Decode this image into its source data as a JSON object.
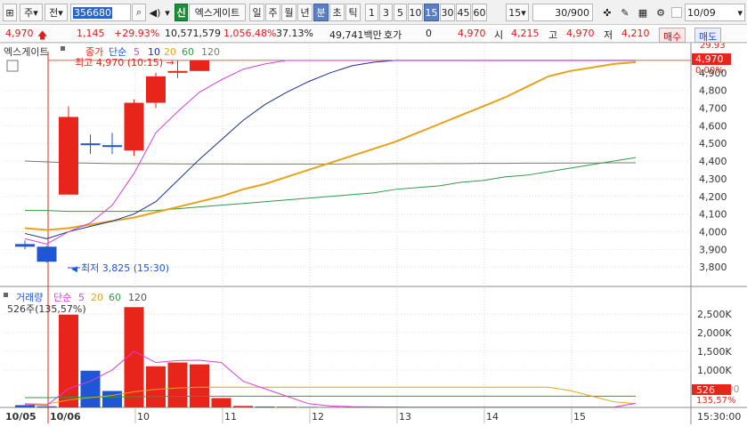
{
  "toolbar": {
    "market_label": "주",
    "type_label": "전",
    "code_value": "356680",
    "name_badge": "신",
    "stock_name": "엑스게이트",
    "periods": [
      "일",
      "주",
      "월",
      "년",
      "분",
      "초",
      "틱"
    ],
    "period_selected": "분",
    "intervals": [
      "1",
      "3",
      "5",
      "10",
      "15",
      "30",
      "45",
      "60"
    ],
    "interval_selected": "15",
    "interval_select": "15",
    "count_value": "30/900",
    "date_value": "10/09"
  },
  "quote": {
    "price": "4,970",
    "change": "1,145",
    "change_pct": "+29.93%",
    "volume": "10,571,579",
    "volume_pct": "1,056.48%",
    "turnover_pct": "37.13%",
    "amount": "49,741백만",
    "hoga_label": "호가",
    "hoga_value": "0",
    "current": "4,970",
    "open_label": "시",
    "open": "4,215",
    "high_label": "고",
    "high": "4,970",
    "low_label": "저",
    "low": "4,210",
    "buy_label": "매수",
    "sell_label": "매도"
  },
  "colors": {
    "up": "#e8251a",
    "down": "#1f56d4",
    "ma5": "#d63fd6",
    "ma10": "#1a2f8f",
    "ma20": "#e8a21a",
    "ma60": "#2e9b45",
    "ma120": "#7a7a6a"
  },
  "chart_data": [
    {
      "type": "candlestick",
      "title": "엑스게이트",
      "legend": [
        "종가",
        "단순",
        "5",
        "10",
        "20",
        "60",
        "120"
      ],
      "x": [
        "10/05 15:00",
        "10/05 15:15",
        "10/06 09:00",
        "10/06 09:15",
        "10/06 09:30",
        "10/06 09:45",
        "10/06 10:00",
        "10/06 10:15",
        "10/06 10:30",
        "10/06 10:45",
        "10/06 11:00",
        "10/06 11:15",
        "10/06 11:30",
        "10/06 11:45",
        "10/06 12:00",
        "10/06 12:15",
        "10/06 12:30",
        "10/06 12:45",
        "10/06 13:00",
        "10/06 13:15",
        "10/06 13:30",
        "10/06 13:45",
        "10/06 14:00",
        "10/06 14:15",
        "10/06 14:30",
        "10/06 14:45",
        "10/06 15:00",
        "10/06 15:15",
        "10/06 15:30"
      ],
      "ohlc": [
        [
          3930,
          3950,
          3900,
          3915
        ],
        [
          3915,
          3920,
          3825,
          3830
        ],
        [
          4210,
          4710,
          4210,
          4650
        ],
        [
          4500,
          4550,
          4440,
          4490
        ],
        [
          4490,
          4560,
          4440,
          4480
        ],
        [
          4460,
          4750,
          4430,
          4730
        ],
        [
          4730,
          4900,
          4700,
          4880
        ],
        [
          4900,
          4970,
          4870,
          4910
        ],
        [
          4910,
          4970,
          4910,
          4970
        ],
        [
          4970,
          4970,
          4970,
          4970
        ],
        [
          4970,
          4970,
          4970,
          4970
        ],
        [
          4970,
          4970,
          4970,
          4970
        ],
        [
          4970,
          4970,
          4970,
          4970
        ],
        [
          4970,
          4970,
          4970,
          4970
        ],
        [
          4970,
          4970,
          4970,
          4970
        ],
        [
          4970,
          4970,
          4970,
          4970
        ],
        [
          4970,
          4970,
          4970,
          4970
        ],
        [
          4970,
          4970,
          4970,
          4970
        ],
        [
          4970,
          4970,
          4970,
          4970
        ],
        [
          4970,
          4970,
          4970,
          4970
        ],
        [
          4970,
          4970,
          4970,
          4970
        ],
        [
          4970,
          4970,
          4970,
          4970
        ],
        [
          4970,
          4970,
          4970,
          4970
        ],
        [
          4970,
          4970,
          4970,
          4970
        ],
        [
          4970,
          4970,
          4970,
          4970
        ],
        [
          4970,
          4970,
          4970,
          4970
        ],
        [
          4970,
          4970,
          4970,
          4970
        ],
        [
          4970,
          4970,
          4970,
          4970
        ],
        [
          4970,
          4970,
          4970,
          4970
        ]
      ],
      "ma5": [
        3960,
        3930,
        4000,
        4050,
        4150,
        4330,
        4560,
        4680,
        4790,
        4860,
        4920,
        4950,
        4970,
        4970,
        4970,
        4970,
        4970,
        4970,
        4970,
        4970,
        4970,
        4970,
        4970,
        4970,
        4970,
        4970,
        4970,
        4970,
        4970
      ],
      "ma10": [
        3990,
        3960,
        4000,
        4030,
        4060,
        4100,
        4170,
        4290,
        4410,
        4520,
        4630,
        4720,
        4790,
        4850,
        4900,
        4940,
        4960,
        4970,
        4970,
        4970,
        4970,
        4970,
        4970,
        4970,
        4970,
        4970,
        4970,
        4970,
        4970
      ],
      "ma20": [
        4020,
        4010,
        4020,
        4040,
        4060,
        4080,
        4110,
        4140,
        4170,
        4200,
        4240,
        4270,
        4310,
        4350,
        4390,
        4430,
        4470,
        4510,
        4560,
        4610,
        4660,
        4710,
        4760,
        4820,
        4880,
        4910,
        4930,
        4950,
        4960
      ],
      "ma60": [
        4120,
        4120,
        4115,
        4115,
        4115,
        4115,
        4120,
        4130,
        4140,
        4150,
        4160,
        4170,
        4180,
        4190,
        4200,
        4210,
        4220,
        4240,
        4250,
        4260,
        4280,
        4290,
        4310,
        4320,
        4340,
        4360,
        4380,
        4400,
        4420
      ],
      "ma120": [
        4400,
        4395,
        4390,
        4388,
        4386,
        4385,
        4385,
        4384,
        4384,
        4384,
        4383,
        4383,
        4383,
        4383,
        4383,
        4384,
        4384,
        4385,
        4385,
        4386,
        4386,
        4387,
        4387,
        4388,
        4388,
        4389,
        4389,
        4390,
        4390
      ],
      "high_annotation": "최고 4,970 (10:15)",
      "low_annotation": "최저 3,825 (15:30)",
      "ylim": [
        3700,
        5030
      ],
      "y_ticks": [
        3800,
        3900,
        4000,
        4100,
        4200,
        4300,
        4400,
        4500,
        4600,
        4700,
        4800
      ],
      "y_tick_labels": [
        "3,800",
        "3,900",
        "4,000",
        "4,100",
        "4,200",
        "4,300",
        "4,400",
        "4,500",
        "4,600",
        "4,700",
        "4,800"
      ],
      "y_top_label": "4,900",
      "right_badges": [
        "29.93",
        "4,970",
        "0.00%"
      ]
    },
    {
      "type": "bar",
      "title": "거래량",
      "legend": [
        "거래량",
        "단순",
        "5",
        "20",
        "60",
        "120"
      ],
      "info": "526주(135,57%)",
      "volume": [
        60,
        30,
        2480,
        980,
        440,
        2680,
        1100,
        1200,
        1150,
        250,
        40,
        25,
        20,
        15,
        12,
        10,
        8,
        8,
        8,
        8,
        8,
        8,
        8,
        8,
        8,
        8,
        8,
        8,
        526
      ],
      "vma5": [
        80,
        60,
        500,
        700,
        1000,
        1500,
        1200,
        1250,
        1260,
        1200,
        700,
        500,
        300,
        100,
        40,
        20,
        15,
        12,
        10,
        10,
        10,
        10,
        10,
        10,
        10,
        10,
        10,
        10,
        110
      ],
      "vma20": [
        100,
        90,
        200,
        260,
        320,
        420,
        480,
        520,
        540,
        540,
        540,
        540,
        540,
        540,
        540,
        540,
        540,
        540,
        540,
        540,
        540,
        540,
        540,
        540,
        540,
        450,
        300,
        150,
        100
      ],
      "vma60": [
        260,
        260,
        270,
        275,
        280,
        285,
        290,
        295,
        300,
        300,
        300,
        300,
        300,
        300,
        300,
        300,
        300,
        300,
        300,
        300,
        300,
        300,
        300,
        300,
        300,
        300,
        300,
        300,
        300
      ],
      "ylim": [
        0,
        2900
      ],
      "y_ticks": [
        1000,
        1500,
        2000,
        2500
      ],
      "y_tick_labels": [
        "1,000K",
        "1,500K",
        "2,000K",
        "2,500K"
      ],
      "y_small_label": "500,000",
      "right_badges": [
        "526",
        "135,57%"
      ]
    }
  ],
  "x_axis": {
    "labels": [
      "10/05",
      "10/06",
      "10",
      "11",
      "12",
      "13",
      "14",
      "15"
    ],
    "end_label": "15:30:00"
  }
}
